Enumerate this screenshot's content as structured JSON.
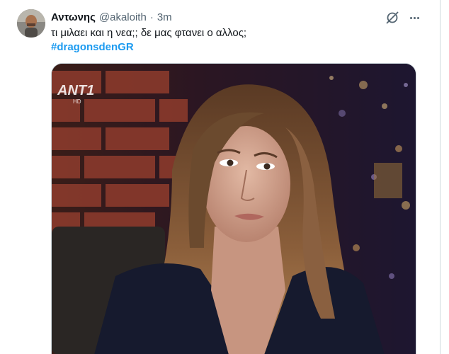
{
  "tweet": {
    "author_name": "Αντωνης",
    "author_handle": "@akaloith",
    "separator": "·",
    "time": "3m",
    "text": "τι μιλαει και η νεα;; δε μας φτανει ο αλλος;",
    "hashtag": "#dragonsdenGR"
  },
  "media": {
    "channel_logo": "ANT1",
    "channel_logo_sub": "HD"
  },
  "icons": {
    "grok": "grok-icon",
    "more": "more-options-icon"
  },
  "colors": {
    "link": "#1d9bf0",
    "secondary_text": "#536471",
    "primary_text": "#0f1419"
  }
}
